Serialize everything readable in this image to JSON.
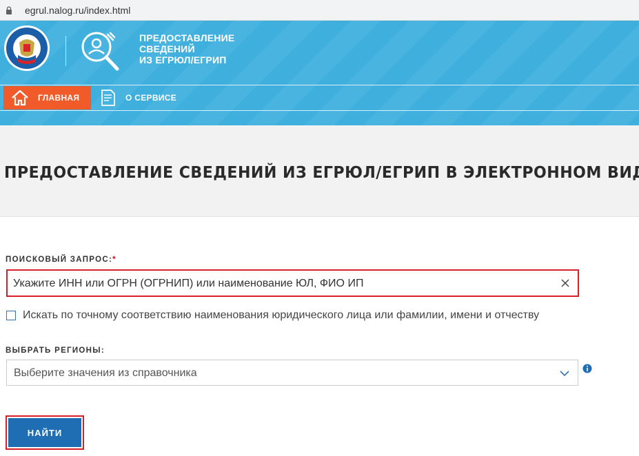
{
  "browser": {
    "url": "egrul.nalog.ru/index.html"
  },
  "header": {
    "service_title_lines": [
      "ПРЕДОСТАВЛЕНИЕ",
      "СВЕДЕНИЙ",
      "ИЗ ЕГРЮЛ/ЕГРИП"
    ],
    "nav": {
      "home_label": "ГЛАВНАЯ",
      "about_label": "О СЕРВИСЕ"
    }
  },
  "page": {
    "title": "ПРЕДОСТАВЛЕНИЕ СВЕДЕНИЙ ИЗ ЕГРЮЛ/ЕГРИП В ЭЛЕКТРОННОМ ВИДЕ"
  },
  "form": {
    "query_label": "ПОИСКОВЫЙ ЗАПРОС:",
    "required_mark": "*",
    "query_placeholder": "Укажите ИНН или ОГРН (ОГРНИП) или наименование ЮЛ, ФИО ИП",
    "query_value": "",
    "exact_match_label": "Искать по точному соответствию наименования юридического лица или фамилии, имени и отчеству",
    "exact_match_checked": false,
    "regions_label": "ВЫБРАТЬ РЕГИОНЫ:",
    "regions_placeholder": "Выберите значения из справочника",
    "submit_label": "НАЙТИ"
  },
  "colors": {
    "header_blue": "#3fb0de",
    "nav_active": "#f15a29",
    "button_blue": "#1f6db2",
    "highlight_red": "#d81f26"
  }
}
